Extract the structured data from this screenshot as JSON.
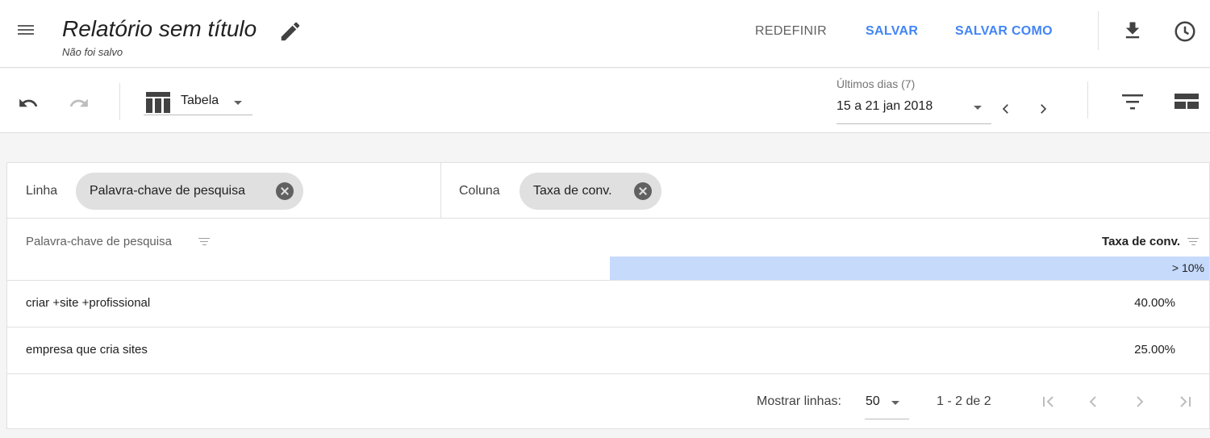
{
  "header": {
    "title": "Relatório sem título",
    "subtitle": "Não foi salvo",
    "actions": {
      "reset": "REDEFINIR",
      "save": "SALVAR",
      "save_as": "SALVAR COMO"
    }
  },
  "toolbar": {
    "visualization": "Tabela",
    "date_range": {
      "label": "Últimos dias (7)",
      "value": "15 a 21 jan 2018"
    }
  },
  "config": {
    "row_label": "Linha",
    "row_chip": "Palavra-chave de pesquisa",
    "column_label": "Coluna",
    "column_chip": "Taxa de conv."
  },
  "table": {
    "headers": {
      "left": "Palavra-chave de pesquisa",
      "right": "Taxa de conv."
    },
    "band_label": "> 10%",
    "rows": [
      {
        "keyword": "criar +site +profissional",
        "value": "40.00%"
      },
      {
        "keyword": "empresa que cria sites",
        "value": "25.00%"
      }
    ]
  },
  "pagination": {
    "rows_label": "Mostrar linhas:",
    "rows_per_page": "50",
    "range_text": "1 - 2 de 2"
  },
  "colors": {
    "accent": "#4285f4",
    "band": "#c6dafc"
  }
}
